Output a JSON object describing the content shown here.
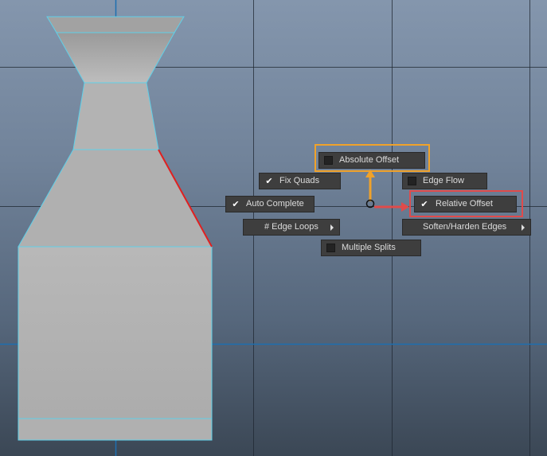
{
  "colors": {
    "highlight_absolute": "#f0a22a",
    "highlight_relative": "#e04b4b",
    "wire": "#5fd0e8",
    "selected_edge": "#e02020",
    "grid_line": "#1f2731",
    "axis_line": "#1e6fb0",
    "mesh_face": "#b4b4b4"
  },
  "menu": {
    "absolute_offset": {
      "label": "Absolute Offset",
      "checked": false
    },
    "fix_quads": {
      "label": "Fix Quads",
      "checked": true
    },
    "edge_flow": {
      "label": "Edge Flow",
      "checked": false
    },
    "auto_complete": {
      "label": "Auto Complete",
      "checked": true
    },
    "relative_offset": {
      "label": "Relative Offset",
      "checked": true
    },
    "edge_loops": {
      "label": "# Edge Loops",
      "has_submenu": true
    },
    "soften_harden": {
      "label": "Soften/Harden Edges",
      "has_submenu": true
    },
    "multiple_splits": {
      "label": "Multiple Splits",
      "checked": false
    }
  },
  "icons": {
    "checkmark": "checkmark-icon",
    "empty_checkbox": "checkbox-empty-icon",
    "submenu_arrow": "submenu-arrow-icon",
    "up_arrow": "arrow-up-icon",
    "right_arrow": "arrow-right-icon",
    "cursor_origin": "marking-menu-origin-icon"
  }
}
